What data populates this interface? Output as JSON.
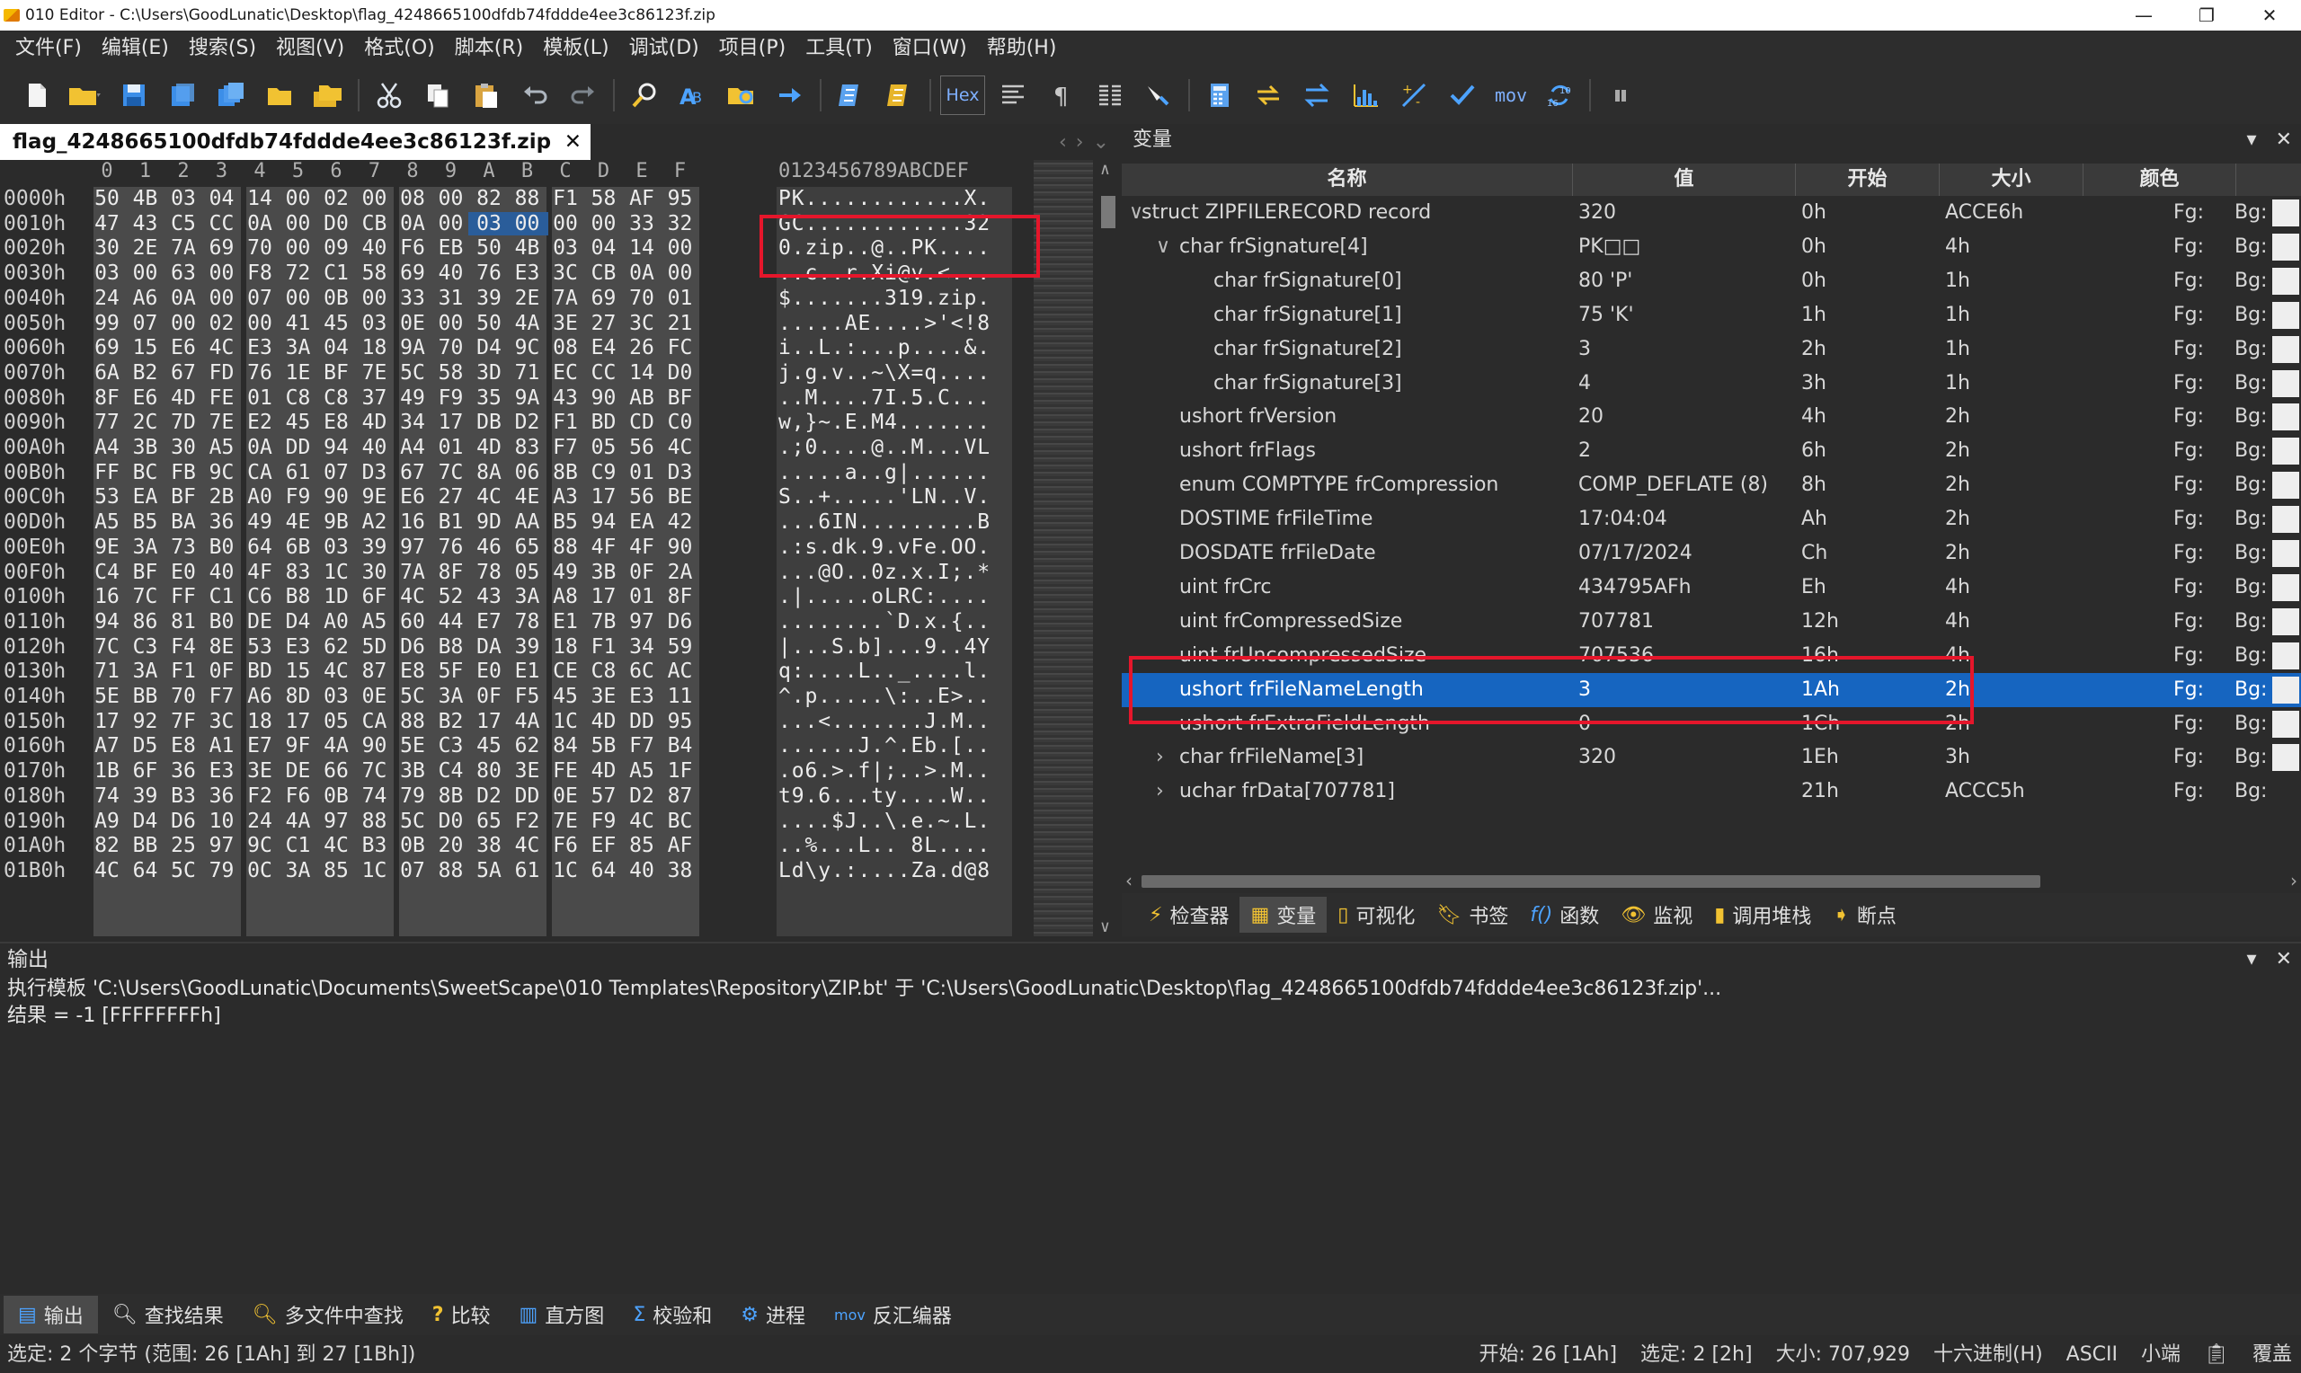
{
  "window": {
    "title": "010 Editor - C:\\Users\\GoodLunatic\\Desktop\\flag_4248665100dfdb74fddde4ee3c86123f.zip",
    "min_label": "—",
    "max_label": "❐",
    "close_label": "✕"
  },
  "menu": [
    "文件(F)",
    "编辑(E)",
    "搜索(S)",
    "视图(V)",
    "格式(O)",
    "脚本(R)",
    "模板(L)",
    "调试(D)",
    "项目(P)",
    "工具(T)",
    "窗口(W)",
    "帮助(H)"
  ],
  "toolbar": {
    "hex_label": "Hex",
    "mov_label": "mov",
    "icons": [
      "new-file-icon",
      "open-folder-icon",
      "save-icon",
      "save-as-icon",
      "save-all-icon",
      "open-folder-2-icon",
      "folder-stack-icon",
      "cut-icon",
      "copy-icon",
      "paste-icon",
      "undo-icon",
      "redo-icon",
      "find-icon",
      "find-replace-icon",
      "find-in-files-icon",
      "goto-icon",
      "run-script-icon",
      "run-template-icon",
      "hex-toggle-icon",
      "text-format-icon",
      "pilcrow-icon",
      "columns-icon",
      "highlight-icon",
      "calculator-icon",
      "base-converter-icon",
      "compare-icon",
      "histogram-icon",
      "checksum-icon",
      "check-icon",
      "disassembler-icon",
      "refresh-icon",
      "pause-icon"
    ]
  },
  "file_tab": {
    "label": "flag_4248665100dfdb74fddde4ee3c86123f.zip",
    "close": "✕"
  },
  "hex": {
    "columns": [
      "0",
      "1",
      "2",
      "3",
      "4",
      "5",
      "6",
      "7",
      "8",
      "9",
      "A",
      "B",
      "C",
      "D",
      "E",
      "F"
    ],
    "ascii_header": "0123456789ABCDEF",
    "rows": [
      {
        "offset": "0000h",
        "bytes": [
          "50",
          "4B",
          "03",
          "04",
          "14",
          "00",
          "02",
          "00",
          "08",
          "00",
          "82",
          "88",
          "F1",
          "58",
          "AF",
          "95"
        ],
        "ascii": "PK............X."
      },
      {
        "offset": "0010h",
        "bytes": [
          "47",
          "43",
          "C5",
          "CC",
          "0A",
          "00",
          "D0",
          "CB",
          "0A",
          "00",
          "03",
          "00",
          "00",
          "00",
          "33",
          "32"
        ],
        "ascii": "GC............32"
      },
      {
        "offset": "0020h",
        "bytes": [
          "30",
          "2E",
          "7A",
          "69",
          "70",
          "00",
          "09",
          "40",
          "F6",
          "EB",
          "50",
          "4B",
          "03",
          "04",
          "14",
          "00"
        ],
        "ascii": "0.zip..@..PK...."
      },
      {
        "offset": "0030h",
        "bytes": [
          "03",
          "00",
          "63",
          "00",
          "F8",
          "72",
          "C1",
          "58",
          "69",
          "40",
          "76",
          "E3",
          "3C",
          "CB",
          "0A",
          "00"
        ],
        "ascii": "..c..r.Xi@v.<..."
      },
      {
        "offset": "0040h",
        "bytes": [
          "24",
          "A6",
          "0A",
          "00",
          "07",
          "00",
          "0B",
          "00",
          "33",
          "31",
          "39",
          "2E",
          "7A",
          "69",
          "70",
          "01"
        ],
        "ascii": "$.......319.zip."
      },
      {
        "offset": "0050h",
        "bytes": [
          "99",
          "07",
          "00",
          "02",
          "00",
          "41",
          "45",
          "03",
          "0E",
          "00",
          "50",
          "4A",
          "3E",
          "27",
          "3C",
          "21",
          "38"
        ],
        "ascii": ".....AE....>'<!8"
      },
      {
        "offset": "0060h",
        "bytes": [
          "69",
          "15",
          "E6",
          "4C",
          "E3",
          "3A",
          "04",
          "18",
          "9A",
          "70",
          "D4",
          "9C",
          "08",
          "E4",
          "26",
          "FC"
        ],
        "ascii": "i..L.:...p....&."
      },
      {
        "offset": "0070h",
        "bytes": [
          "6A",
          "B2",
          "67",
          "FD",
          "76",
          "1E",
          "BF",
          "7E",
          "5C",
          "58",
          "3D",
          "71",
          "EC",
          "CC",
          "14",
          "D0"
        ],
        "ascii": "j.g.v..~\\X=q...."
      },
      {
        "offset": "0080h",
        "bytes": [
          "8F",
          "E6",
          "4D",
          "FE",
          "01",
          "C8",
          "C8",
          "37",
          "49",
          "F9",
          "35",
          "9A",
          "43",
          "90",
          "AB",
          "BF"
        ],
        "ascii": "..M....7I.5.C..."
      },
      {
        "offset": "0090h",
        "bytes": [
          "77",
          "2C",
          "7D",
          "7E",
          "E2",
          "45",
          "E8",
          "4D",
          "34",
          "17",
          "DB",
          "D2",
          "F1",
          "BD",
          "CD",
          "C0"
        ],
        "ascii": "w,}~.E.M4......."
      },
      {
        "offset": "00A0h",
        "bytes": [
          "A4",
          "3B",
          "30",
          "A5",
          "0A",
          "DD",
          "94",
          "40",
          "A4",
          "01",
          "4D",
          "83",
          "F7",
          "05",
          "56",
          "4C"
        ],
        "ascii": ".;0....@..M...VL"
      },
      {
        "offset": "00B0h",
        "bytes": [
          "FF",
          "BC",
          "FB",
          "9C",
          "CA",
          "61",
          "07",
          "D3",
          "67",
          "7C",
          "8A",
          "06",
          "8B",
          "C9",
          "01",
          "D3"
        ],
        "ascii": ".....a..g|......"
      },
      {
        "offset": "00C0h",
        "bytes": [
          "53",
          "EA",
          "BF",
          "2B",
          "A0",
          "F9",
          "90",
          "9E",
          "E6",
          "27",
          "4C",
          "4E",
          "A3",
          "17",
          "56",
          "BE"
        ],
        "ascii": "S..+.....'LN..V."
      },
      {
        "offset": "00D0h",
        "bytes": [
          "A5",
          "B5",
          "BA",
          "36",
          "49",
          "4E",
          "9B",
          "A2",
          "16",
          "B1",
          "9D",
          "AA",
          "B5",
          "94",
          "EA",
          "42"
        ],
        "ascii": "...6IN.........B"
      },
      {
        "offset": "00E0h",
        "bytes": [
          "9E",
          "3A",
          "73",
          "B0",
          "64",
          "6B",
          "03",
          "39",
          "97",
          "76",
          "46",
          "65",
          "88",
          "4F",
          "4F",
          "90"
        ],
        "ascii": ".:s.dk.9.vFe.OO."
      },
      {
        "offset": "00F0h",
        "bytes": [
          "C4",
          "BF",
          "E0",
          "40",
          "4F",
          "83",
          "1C",
          "30",
          "7A",
          "8F",
          "78",
          "05",
          "49",
          "3B",
          "0F",
          "2A"
        ],
        "ascii": "...@O..0z.x.I;.*"
      },
      {
        "offset": "0100h",
        "bytes": [
          "16",
          "7C",
          "FF",
          "C1",
          "C6",
          "B8",
          "1D",
          "6F",
          "4C",
          "52",
          "43",
          "3A",
          "A8",
          "17",
          "01",
          "8F"
        ],
        "ascii": ".|.....oLRC:...."
      },
      {
        "offset": "0110h",
        "bytes": [
          "94",
          "86",
          "81",
          "B0",
          "DE",
          "D4",
          "A0",
          "A5",
          "60",
          "44",
          "E7",
          "78",
          "E1",
          "7B",
          "97",
          "D6"
        ],
        "ascii": "........`D.x.{.."
      },
      {
        "offset": "0120h",
        "bytes": [
          "7C",
          "C3",
          "F4",
          "8E",
          "53",
          "E3",
          "62",
          "5D",
          "D6",
          "B8",
          "DA",
          "39",
          "18",
          "F1",
          "34",
          "59"
        ],
        "ascii": "|...S.b]...9..4Y"
      },
      {
        "offset": "0130h",
        "bytes": [
          "71",
          "3A",
          "F1",
          "0F",
          "BD",
          "15",
          "4C",
          "87",
          "E8",
          "5F",
          "E0",
          "E1",
          "CE",
          "C8",
          "6C",
          "AC"
        ],
        "ascii": "q:....L.._....l."
      },
      {
        "offset": "0140h",
        "bytes": [
          "5E",
          "BB",
          "70",
          "F7",
          "A6",
          "8D",
          "03",
          "0E",
          "5C",
          "3A",
          "0F",
          "F5",
          "45",
          "3E",
          "E3",
          "11"
        ],
        "ascii": "^.p.....\\:..E>.."
      },
      {
        "offset": "0150h",
        "bytes": [
          "17",
          "92",
          "7F",
          "3C",
          "18",
          "17",
          "05",
          "CA",
          "88",
          "B2",
          "17",
          "4A",
          "1C",
          "4D",
          "DD",
          "95"
        ],
        "ascii": "...<.......J.M.."
      },
      {
        "offset": "0160h",
        "bytes": [
          "A7",
          "D5",
          "E8",
          "A1",
          "E7",
          "9F",
          "4A",
          "90",
          "5E",
          "C3",
          "45",
          "62",
          "84",
          "5B",
          "F7",
          "B4"
        ],
        "ascii": "......J.^.Eb.[.."
      },
      {
        "offset": "0170h",
        "bytes": [
          "1B",
          "6F",
          "36",
          "E3",
          "3E",
          "DE",
          "66",
          "7C",
          "3B",
          "C4",
          "80",
          "3E",
          "FE",
          "4D",
          "A5",
          "1F"
        ],
        "ascii": ".o6.>.f|;..>.M.."
      },
      {
        "offset": "0180h",
        "bytes": [
          "74",
          "39",
          "B3",
          "36",
          "F2",
          "F6",
          "0B",
          "74",
          "79",
          "8B",
          "D2",
          "DD",
          "0E",
          "57",
          "D2",
          "87"
        ],
        "ascii": "t9.6...ty....W.."
      },
      {
        "offset": "0190h",
        "bytes": [
          "A9",
          "D4",
          "D6",
          "10",
          "24",
          "4A",
          "97",
          "88",
          "5C",
          "D0",
          "65",
          "F2",
          "7E",
          "F9",
          "4C",
          "BC"
        ],
        "ascii": "....$J..\\.e.~.L."
      },
      {
        "offset": "01A0h",
        "bytes": [
          "82",
          "BB",
          "25",
          "97",
          "9C",
          "C1",
          "4C",
          "B3",
          "0B",
          "20",
          "38",
          "4C",
          "F6",
          "EF",
          "85",
          "AF"
        ],
        "ascii": "..%...L.. 8L...."
      },
      {
        "offset": "01B0h",
        "bytes": [
          "4C",
          "64",
          "5C",
          "79",
          "0C",
          "3A",
          "85",
          "1C",
          "07",
          "88",
          "5A",
          "61",
          "1C",
          "64",
          "40",
          "38"
        ],
        "ascii": "Ld\\y.:....Za.d@8"
      }
    ]
  },
  "variables": {
    "title": "变量",
    "headers": {
      "name": "名称",
      "value": "值",
      "start": "开始",
      "size": "大小",
      "color": "颜色"
    },
    "fg_label": "Fg:",
    "bg_label": "Bg:",
    "rows": [
      {
        "arrow": "∨",
        "name": "struct ZIPFILERECORD record",
        "value": "320",
        "start": "0h",
        "size": "ACCE6h"
      },
      {
        "arrow": "∨",
        "name": "char frSignature[4]",
        "value": "PK□□",
        "start": "0h",
        "size": "4h"
      },
      {
        "arrow": "",
        "name": "char frSignature[0]",
        "value": "80 'P'",
        "start": "0h",
        "size": "1h"
      },
      {
        "arrow": "",
        "name": "char frSignature[1]",
        "value": "75 'K'",
        "start": "1h",
        "size": "1h"
      },
      {
        "arrow": "",
        "name": "char frSignature[2]",
        "value": "3",
        "start": "2h",
        "size": "1h"
      },
      {
        "arrow": "",
        "name": "char frSignature[3]",
        "value": "4",
        "start": "3h",
        "size": "1h"
      },
      {
        "arrow": "",
        "name": "ushort frVersion",
        "value": "20",
        "start": "4h",
        "size": "2h"
      },
      {
        "arrow": "",
        "name": "ushort frFlags",
        "value": "2",
        "start": "6h",
        "size": "2h"
      },
      {
        "arrow": "",
        "name": "enum COMPTYPE frCompression",
        "value": "COMP_DEFLATE (8)",
        "start": "8h",
        "size": "2h"
      },
      {
        "arrow": "",
        "name": "DOSTIME frFileTime",
        "value": "17:04:04",
        "start": "Ah",
        "size": "2h"
      },
      {
        "arrow": "",
        "name": "DOSDATE frFileDate",
        "value": "07/17/2024",
        "start": "Ch",
        "size": "2h"
      },
      {
        "arrow": "",
        "name": "uint frCrc",
        "value": "434795AFh",
        "start": "Eh",
        "size": "4h"
      },
      {
        "arrow": "",
        "name": "uint frCompressedSize",
        "value": "707781",
        "start": "12h",
        "size": "4h"
      },
      {
        "arrow": "",
        "name": "uint frUncompressedSize",
        "value": "707536",
        "start": "16h",
        "size": "4h"
      },
      {
        "arrow": "",
        "name": "ushort frFileNameLength",
        "value": "3",
        "start": "1Ah",
        "size": "2h"
      },
      {
        "arrow": "",
        "name": "ushort frExtraFieldLength",
        "value": "0",
        "start": "1Ch",
        "size": "2h"
      },
      {
        "arrow": "›",
        "name": "char frFileName[3]",
        "value": "320",
        "start": "1Eh",
        "size": "3h"
      },
      {
        "arrow": "›",
        "name": "uchar frData[707781]",
        "value": "",
        "start": "21h",
        "size": "ACCC5h"
      }
    ]
  },
  "panel_tabs": [
    "检查器",
    "变量",
    "可视化",
    "书签",
    "函数",
    "监视",
    "调用堆栈",
    "断点"
  ],
  "output": {
    "title": "输出",
    "lines": [
      "执行模板 'C:\\Users\\GoodLunatic\\Documents\\SweetScape\\010 Templates\\Repository\\ZIP.bt' 于 'C:\\Users\\GoodLunatic\\Desktop\\flag_4248665100dfdb74fddde4ee3c86123f.zip'...",
      "结果 = -1 [FFFFFFFFh]"
    ]
  },
  "bottom_tabs": [
    "输出",
    "查找结果",
    "多文件中查找",
    "比较",
    "直方图",
    "校验和",
    "进程",
    "反汇编器"
  ],
  "status": {
    "selection": "选定: 2 个字节 (范围: 26 [1Ah] 到 27 [1Bh])",
    "start": "开始: 26 [1Ah]",
    "selected": "选定: 2 [2h]",
    "size": "大小: 707,929",
    "mode": "十六进制(H)",
    "charset": "ASCII",
    "endian": "小端",
    "insert": "覆盖"
  },
  "colors": {
    "selection_blue": "#1665c0",
    "highlight_red": "#e5162b",
    "hex_selected": "#2a5d9a"
  }
}
